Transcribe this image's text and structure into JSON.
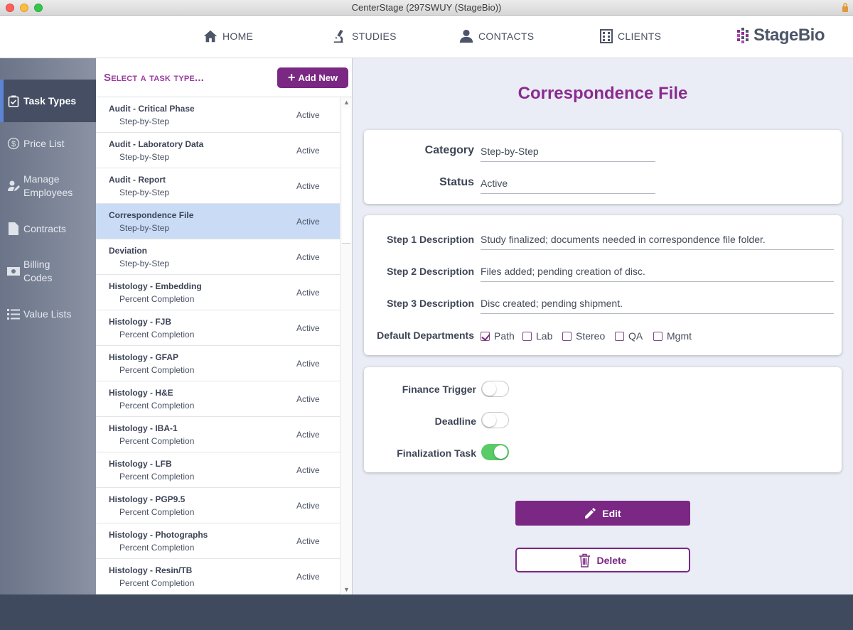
{
  "window": {
    "title": "CenterStage (297SWUY (StageBio))"
  },
  "nav": {
    "items": [
      {
        "label": "HOME",
        "icon": "home-icon"
      },
      {
        "label": "STUDIES",
        "icon": "microscope-icon"
      },
      {
        "label": "CONTACTS",
        "icon": "person-icon"
      },
      {
        "label": "CLIENTS",
        "icon": "building-icon"
      }
    ],
    "brand": "StageBio"
  },
  "sidebar": {
    "items": [
      {
        "label": "Task Types",
        "icon": "clipboard-check-icon",
        "active": true
      },
      {
        "label": "Price List",
        "icon": "dollar-circle-icon"
      },
      {
        "label": "Manage Employees",
        "icon": "user-edit-icon"
      },
      {
        "label": "Contracts",
        "icon": "document-icon"
      },
      {
        "label": "Billing Codes",
        "icon": "money-bill-icon"
      },
      {
        "label": "Value Lists",
        "icon": "list-icon"
      }
    ]
  },
  "list": {
    "title": "Select a task type...",
    "add_label": "Add New",
    "rows": [
      {
        "name": "Audit - Critical Phase",
        "category": "Step-by-Step",
        "status": "Active"
      },
      {
        "name": "Audit - Laboratory Data",
        "category": "Step-by-Step",
        "status": "Active"
      },
      {
        "name": "Audit - Report",
        "category": "Step-by-Step",
        "status": "Active"
      },
      {
        "name": "Correspondence File",
        "category": "Step-by-Step",
        "status": "Active",
        "selected": true
      },
      {
        "name": "Deviation",
        "category": "Step-by-Step",
        "status": "Active"
      },
      {
        "name": "Histology - Embedding",
        "category": "Percent Completion",
        "status": "Active"
      },
      {
        "name": "Histology - FJB",
        "category": "Percent Completion",
        "status": "Active"
      },
      {
        "name": "Histology - GFAP",
        "category": "Percent Completion",
        "status": "Active"
      },
      {
        "name": "Histology - H&E",
        "category": "Percent Completion",
        "status": "Active"
      },
      {
        "name": "Histology - IBA-1",
        "category": "Percent Completion",
        "status": "Active"
      },
      {
        "name": "Histology - LFB",
        "category": "Percent Completion",
        "status": "Active"
      },
      {
        "name": "Histology - PGP9.5",
        "category": "Percent Completion",
        "status": "Active"
      },
      {
        "name": "Histology - Photographs",
        "category": "Percent Completion",
        "status": "Active"
      },
      {
        "name": "Histology - Resin/TB",
        "category": "Percent Completion",
        "status": "Active"
      }
    ]
  },
  "detail": {
    "title": "Correspondence File",
    "category_label": "Category",
    "category_value": "Step-by-Step",
    "status_label": "Status",
    "status_value": "Active",
    "step1_label": "Step 1 Description",
    "step1_value": "Study finalized; documents needed in correspondence file folder.",
    "step2_label": "Step 2 Description",
    "step2_value": "Files added; pending creation of disc.",
    "step3_label": "Step 3 Description",
    "step3_value": "Disc created; pending shipment.",
    "departments_label": "Default Departments",
    "departments": [
      {
        "label": "Path",
        "checked": true
      },
      {
        "label": "Lab",
        "checked": false
      },
      {
        "label": "Stereo",
        "checked": false
      },
      {
        "label": "QA",
        "checked": false
      },
      {
        "label": "Mgmt",
        "checked": false
      }
    ],
    "finance_label": "Finance Trigger",
    "finance_on": false,
    "deadline_label": "Deadline",
    "deadline_on": false,
    "finalization_label": "Finalization Task",
    "finalization_on": true,
    "edit_label": "Edit",
    "delete_label": "Delete"
  },
  "colors": {
    "accent": "#7a2883",
    "sidebar": "#6b7488",
    "selected_row": "#c9dbf5",
    "toggle_on": "#5acb67"
  }
}
